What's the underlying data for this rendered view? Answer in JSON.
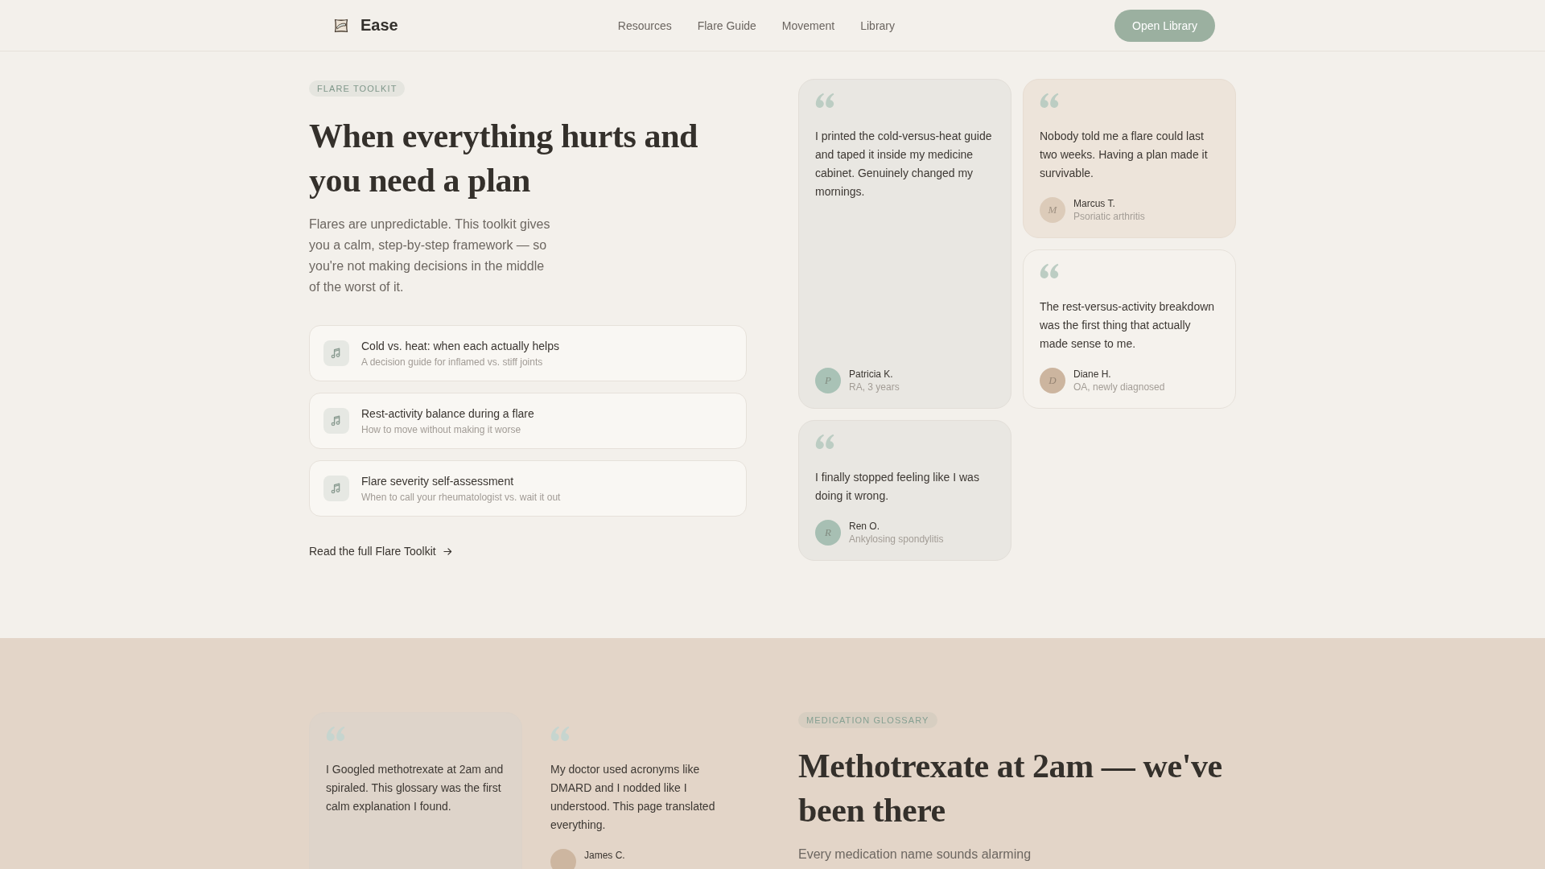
{
  "header": {
    "brand": "Ease",
    "nav": [
      "Resources",
      "Flare Guide",
      "Movement",
      "Library"
    ],
    "button": "Open Library"
  },
  "sections": [
    {
      "badge": "FLARE TOOLKIT",
      "title": "When everything hurts and you need a plan",
      "intro": "Flares are unpredictable. This toolkit gives you a calm, step-by-step framework — so you're not making decisions in the middle of the worst of it.",
      "guides": [
        {
          "title": "Cold vs. heat: when each actually helps",
          "description": "A decision guide for inflamed vs. stiff joints"
        },
        {
          "title": "Rest-activity balance during a flare",
          "description": "How to move without making it worse"
        },
        {
          "title": "Flare severity self-assessment",
          "description": "When to call your rheumatologist vs. wait it out"
        }
      ],
      "link": "Read the full Flare Toolkit",
      "testimonials": [
        {
          "quote": "I printed the cold-versus-heat guide and taped it inside my medicine cabinet. Genuinely changed my mornings.",
          "avatar": {
            "initial": "P",
            "color": "#a9c2b6"
          },
          "author": {
            "name": "Patricia K.",
            "detail": "RA, 3 years"
          }
        },
        {
          "quote": "Nobody told me a flare could last two weeks. Having a plan made it survivable.",
          "avatar": {
            "initial": "M",
            "color": "#dccbb9"
          },
          "author": {
            "name": "Marcus T.",
            "detail": "Psoriatic arthritis"
          }
        },
        {
          "quote": "The rest-versus-activity breakdown was the first thing that actually made sense to me.",
          "avatar": {
            "initial": "D",
            "color": "#ccb59f"
          },
          "author": {
            "name": "Diane H.",
            "detail": "OA, newly diagnosed"
          }
        },
        {
          "quote": "I finally stopped feeling like I was doing it wrong.",
          "avatar": {
            "initial": "R",
            "color": "#a7bfb3"
          },
          "author": {
            "name": "Ren O.",
            "detail": "Ankylosing spondylitis"
          }
        }
      ]
    },
    {
      "badge": "MEDICATION GLOSSARY",
      "title": "Methotrexate at 2am — we've been there",
      "intro": "Every medication name sounds alarming",
      "testimonials": [
        {
          "quote": "I Googled methotrexate at 2am and spiraled. This glossary was the first calm explanation I found."
        },
        {
          "quote": "My doctor used acronyms like DMARD and I nodded like I understood. This page translated everything.",
          "avatar": {
            "color": "#cdb6a0"
          },
          "author": {
            "name": "James C."
          }
        }
      ]
    }
  ]
}
